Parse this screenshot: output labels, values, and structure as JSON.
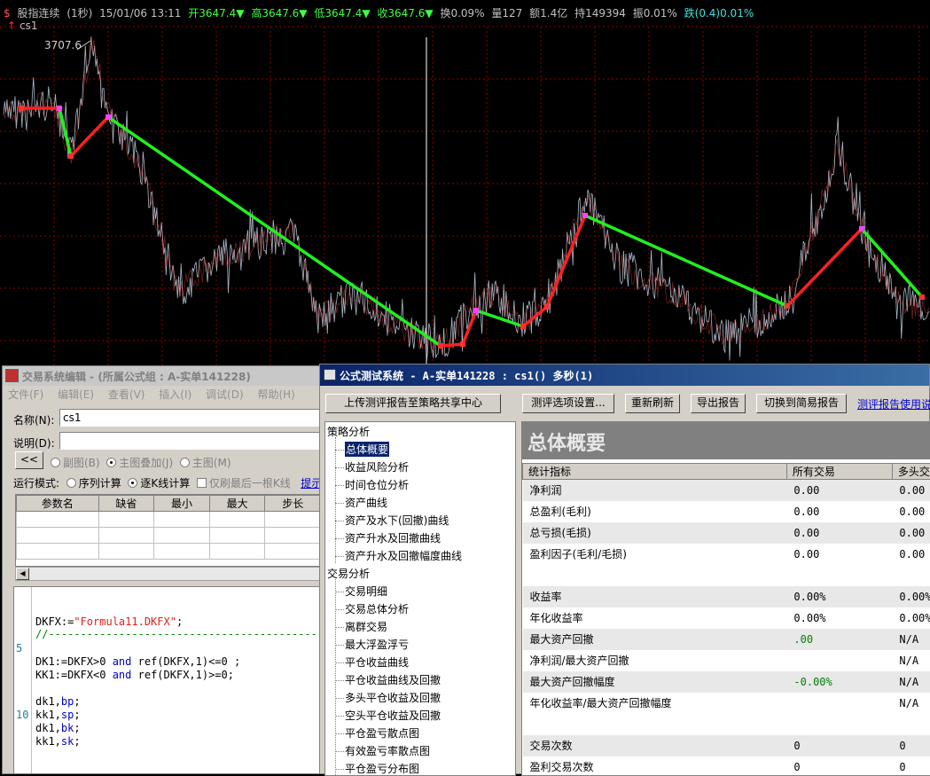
{
  "chart": {
    "header": {
      "name": "股指连续",
      "period": "(1秒)",
      "datetime": "15/01/06 13:11",
      "open": "开3647.4▼",
      "high": "高3647.6▼",
      "low": "低3647.4▼",
      "close": "收3647.6▼",
      "turnover": "换0.09%",
      "volume": "量127",
      "amount": "额1.4亿",
      "hold": "持149394",
      "amplitude": "振0.01%",
      "change": "跌(0.4)0.01%"
    },
    "indicator_name": "cs1",
    "high_label": "3707.6",
    "colors": {
      "long": "#ff2020",
      "short": "#20f020",
      "bg": "#000000",
      "grid": "#8b0000"
    }
  },
  "editor": {
    "title": "交易系统编辑 - (所属公式组 : A-实单141228)",
    "menu": [
      "文件(F)",
      "编辑(E)",
      "查看(V)",
      "插入(I)",
      "调试(D)",
      "帮助(H)"
    ],
    "name_label": "名称(N):",
    "name_value": "cs1",
    "desc_label": "说明(D):",
    "desc_value": "",
    "collapse_btn": "<<",
    "chart_opts": [
      "副图(B)",
      "主图叠加(J)",
      "主图(M)"
    ],
    "run_mode_label": "运行模式:",
    "run_modes": [
      "序列计算",
      "逐K线计算"
    ],
    "refresh_opt": "仅刷最后一根K线",
    "link_text": "提示",
    "param_headers": [
      "参数名",
      "缺省",
      "最小",
      "最大",
      "步长"
    ],
    "line_numbers": [
      "5",
      "10"
    ],
    "code": {
      "l1_var": "DKFX:=",
      "l1_str": "\"Formula11.DKFX\"",
      "l1_end": ";",
      "l2": "//------------------------------------------------",
      "l3a": "DK1:=DKFX>0 ",
      "l3b": "and",
      "l3c": " ref(DKFX,1)<=0 ;",
      "l4a": "KK1:=DKFX<0 ",
      "l4b": "and",
      "l4c": " ref(DKFX,1)>=0;",
      "l5a": "dk1,",
      "l5b": "bp",
      "l5c": ";",
      "l6a": "kk1,",
      "l6b": "sp",
      "l6c": ";",
      "l7a": "dk1,",
      "l7b": "bk",
      "l7c": ";",
      "l8a": "kk1,",
      "l8b": "sk",
      "l8c": ";"
    }
  },
  "report": {
    "title": "公式测试系统 - A-实单141228 : cs1() 多秒(1)",
    "upload_btn": "上传测评报告至策略共享中心",
    "options_btn": "测评选项设置...",
    "refresh_btn": "重新刷新",
    "export_btn": "导出报告",
    "simple_btn": "切换到简易报告",
    "help_link": "测评报告使用说",
    "tree": {
      "group1": "策略分析",
      "group1_items": [
        "总体概要",
        "收益风险分析",
        "时间仓位分析",
        "资产曲线",
        "资产及水下(回撤)曲线",
        "资产升水及回撤曲线",
        "资产升水及回撤幅度曲线"
      ],
      "group2": "交易分析",
      "group2_items": [
        "交易明细",
        "交易总体分析",
        "离群交易",
        "最大浮盈浮亏",
        "平仓收益曲线",
        "平仓收益曲线及回撤",
        "多头平仓收益及回撤",
        "空头平仓收益及回撤",
        "平仓盈亏散点图",
        "有效盈亏率散点图",
        "平仓盈亏分布图"
      ]
    },
    "heading": "总体概要",
    "columns": [
      "统计指标",
      "所有交易",
      "多头交"
    ],
    "rows": [
      {
        "name": "净利润",
        "all": "0.00",
        "long": "0.00"
      },
      {
        "name": "总盈利(毛利)",
        "all": "0.00",
        "long": "0.00"
      },
      {
        "name": "总亏损(毛损)",
        "all": "0.00",
        "long": "0.00"
      },
      {
        "name": "盈利因子(毛利/毛损)",
        "all": "0.00",
        "long": "0.00"
      },
      {
        "name": "",
        "all": "",
        "long": ""
      },
      {
        "name": "收益率",
        "all": "0.00%",
        "long": "0.00%"
      },
      {
        "name": "年化收益率",
        "all": "0.00%",
        "long": "0.00%"
      },
      {
        "name": "最大资产回撤",
        "all": ".00",
        "long": "N/A"
      },
      {
        "name": "净利润/最大资产回撤",
        "all": "",
        "long": "N/A"
      },
      {
        "name": "最大资产回撤幅度",
        "all": "-0.00%",
        "long": "N/A"
      },
      {
        "name": "年化收益率/最大资产回撤幅度",
        "all": "",
        "long": "N/A"
      },
      {
        "name": "",
        "all": "",
        "long": ""
      },
      {
        "name": "交易次数",
        "all": "0",
        "long": "0"
      },
      {
        "name": "盈利交易次数",
        "all": "0",
        "long": "0"
      }
    ]
  }
}
